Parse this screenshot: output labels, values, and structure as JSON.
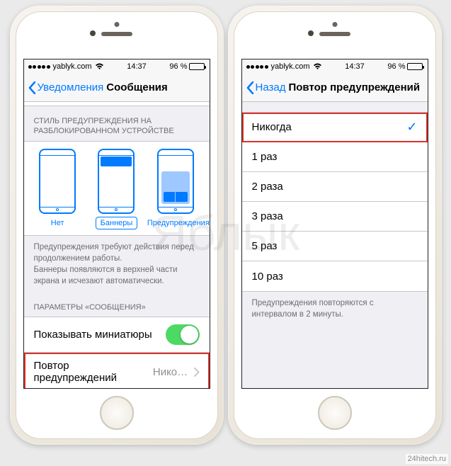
{
  "status": {
    "carrier": "yablyk.com",
    "time": "14:37",
    "battery_pct": "96 %"
  },
  "left": {
    "back_label": "Уведомления",
    "title": "Сообщения",
    "style_header": "СТИЛЬ ПРЕДУПРЕЖДЕНИЯ НА РАЗБЛОКИРОВАННОМ УСТРОЙСТВЕ",
    "styles": {
      "none": "Нет",
      "banners": "Баннеры",
      "alerts": "Предупреждения"
    },
    "style_footer_1": "Предупреждения требуют действия перед продолжением работы.",
    "style_footer_2": "Баннеры появляются в верхней части экрана и исчезают автоматически.",
    "params_header": "ПАРАМЕТРЫ «СООБЩЕНИЯ»",
    "show_previews_label": "Показывать миниатюры",
    "repeat_label": "Повтор предупреждений",
    "repeat_value": "Никог…"
  },
  "right": {
    "back_label": "Назад",
    "title": "Повтор предупреждений",
    "options": [
      "Никогда",
      "1 раз",
      "2 раза",
      "3 раза",
      "5 раз",
      "10 раз"
    ],
    "footer": "Предупреждения повторяются с интервалом в 2 минуты."
  },
  "watermark": "Яблык",
  "credit": "24hitech.ru"
}
